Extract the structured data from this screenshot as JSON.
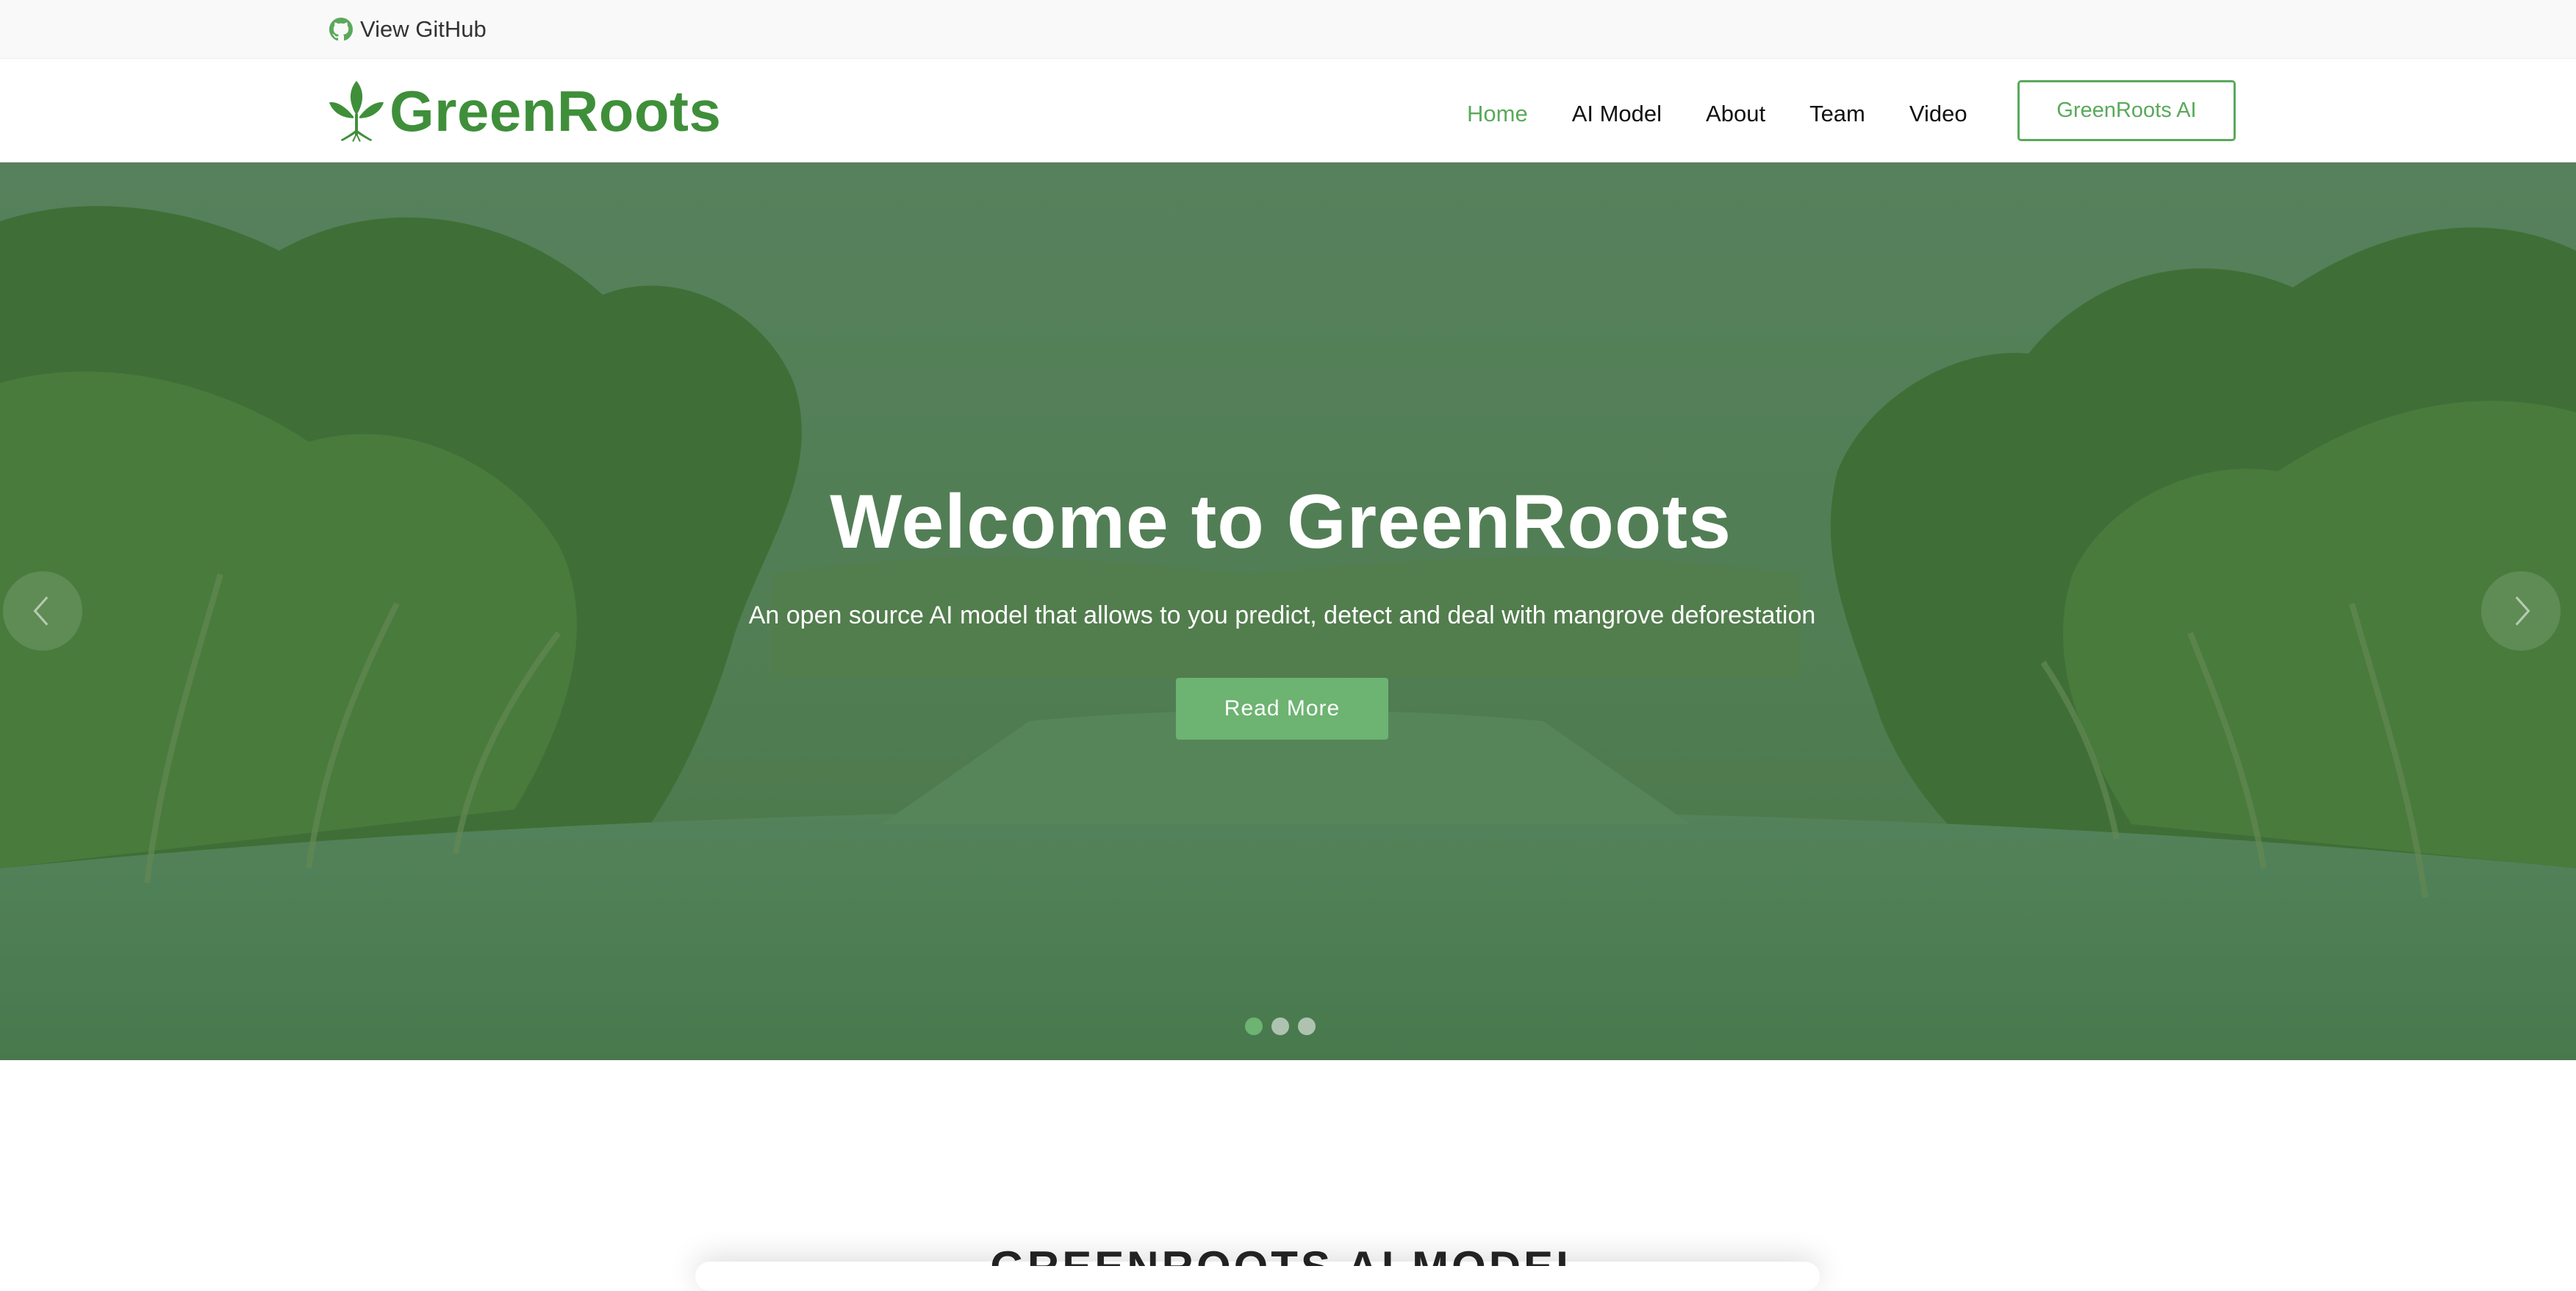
{
  "topbar": {
    "github_label": "View GitHub",
    "github_icon": "github-icon"
  },
  "header": {
    "brand_name": "GreenRoots",
    "brand_icon": "leaf-icon",
    "nav": [
      {
        "label": "Home",
        "active": true
      },
      {
        "label": "AI Model",
        "active": false
      },
      {
        "label": "About",
        "active": false
      },
      {
        "label": "Team",
        "active": false
      },
      {
        "label": "Video",
        "active": false
      }
    ],
    "cta_label": "GreenRoots AI"
  },
  "hero": {
    "title": "Welcome to GreenRoots",
    "subtitle": "An open source AI model that allows to you predict, detect and deal with mangrove deforestation",
    "button_label": "Read More",
    "slides_count": 3,
    "active_slide": 1,
    "prev_icon": "chevron-left-icon",
    "next_icon": "chevron-right-icon"
  },
  "section": {
    "title_partial": "GREENROOTS AI MODEL"
  },
  "colors": {
    "brand_green": "#3f8f3a",
    "accent_green": "#5aa95b",
    "button_green": "#6db372",
    "hero_overlay": "#4f7a4d"
  }
}
